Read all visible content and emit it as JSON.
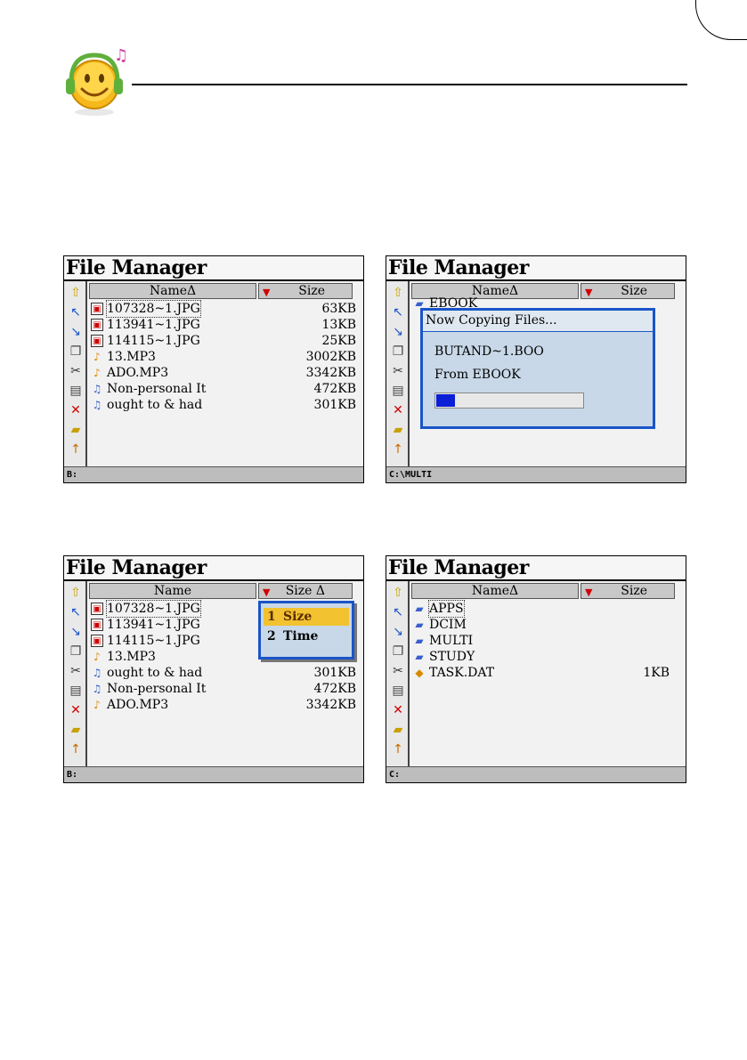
{
  "screens": [
    {
      "title": "File Manager",
      "header": {
        "name": "NameΔ",
        "size": "Size"
      },
      "files": [
        {
          "icon": "image-file-icon",
          "name": "107328~1.JPG",
          "size": "63KB",
          "selected": true
        },
        {
          "icon": "image-file-icon",
          "name": "113941~1.JPG",
          "size": "13KB"
        },
        {
          "icon": "image-file-icon",
          "name": "114115~1.JPG",
          "size": "25KB"
        },
        {
          "icon": "mp3-file-icon",
          "name": "13.MP3",
          "size": "3002KB"
        },
        {
          "icon": "mp3-file-icon",
          "name": "ADO.MP3",
          "size": "3342KB"
        },
        {
          "icon": "text-file-icon",
          "name": "Non-personal It",
          "size": "472KB"
        },
        {
          "icon": "text-file-icon",
          "name": "ought to & had",
          "size": "301KB"
        }
      ],
      "status": "B:"
    },
    {
      "title": "File Manager",
      "header": {
        "name": "NameΔ",
        "size": "Size"
      },
      "files": [
        {
          "icon": "folder-icon",
          "name": "EBOOK",
          "size": ""
        }
      ],
      "dialog": {
        "title": "Now Copying Files...",
        "file": "BUTAND~1.BOO",
        "from": "From EBOOK",
        "progress": 0.13
      },
      "status": "C:\\MULTI"
    },
    {
      "title": "File Manager",
      "header": {
        "name": "Name",
        "size": "Size Δ"
      },
      "files": [
        {
          "icon": "image-file-icon",
          "name": "107328~1.JPG",
          "size": "",
          "selected": true
        },
        {
          "icon": "image-file-icon",
          "name": "113941~1.JPG",
          "size": ""
        },
        {
          "icon": "image-file-icon",
          "name": "114115~1.JPG",
          "size": ""
        },
        {
          "icon": "mp3-file-icon",
          "name": "13.MP3",
          "size": ""
        },
        {
          "icon": "text-file-icon",
          "name": "ought to & had",
          "size": "301KB"
        },
        {
          "icon": "text-file-icon",
          "name": "Non-personal It",
          "size": "472KB"
        },
        {
          "icon": "mp3-file-icon",
          "name": "ADO.MP3",
          "size": "3342KB"
        }
      ],
      "sort_menu": [
        {
          "num": "1",
          "label": "Size",
          "active": true
        },
        {
          "num": "2",
          "label": "Time",
          "active": false
        }
      ],
      "status": "B:"
    },
    {
      "title": "File Manager",
      "header": {
        "name": "NameΔ",
        "size": "Size"
      },
      "files": [
        {
          "icon": "folder-icon",
          "name": "APPS",
          "size": "",
          "selected": true
        },
        {
          "icon": "folder-icon",
          "name": "DCIM",
          "size": ""
        },
        {
          "icon": "folder-icon",
          "name": "MULTI",
          "size": ""
        },
        {
          "icon": "folder-icon",
          "name": "STUDY",
          "size": ""
        },
        {
          "icon": "data-file-icon",
          "name": "TASK.DAT",
          "size": "1KB"
        }
      ],
      "status": "C:"
    }
  ],
  "toolbar_icons": [
    "go-up-icon",
    "back-icon",
    "forward-icon",
    "copy-icon",
    "cut-icon",
    "paste-icon",
    "delete-icon",
    "new-folder-icon",
    "rename-icon"
  ]
}
